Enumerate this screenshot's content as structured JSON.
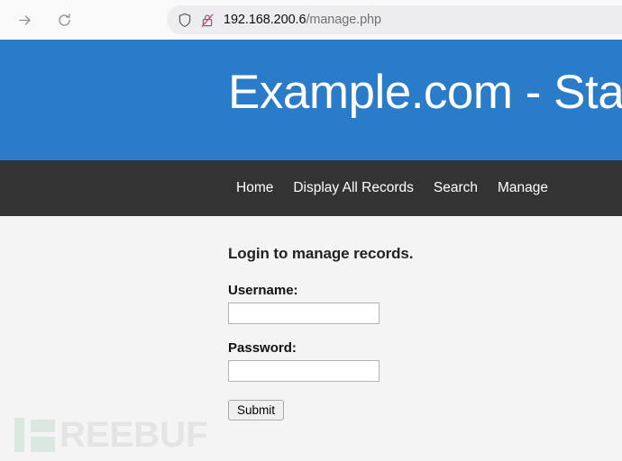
{
  "browser": {
    "forward_label": "Forward",
    "reload_label": "Reload",
    "url_host": "192.168.200.6",
    "url_path": "/manage.php",
    "shield_icon": "shield-icon",
    "insecure_icon": "lock-crossed-icon"
  },
  "site": {
    "banner_title": "Example.com - Staff",
    "banner_color": "#2b7cc8",
    "navbar_color": "#333333",
    "page_background": "#f4f4f4",
    "nav": [
      {
        "label": "Home"
      },
      {
        "label": "Display All Records"
      },
      {
        "label": "Search"
      },
      {
        "label": "Manage"
      }
    ]
  },
  "form": {
    "heading": "Login to manage records.",
    "username_label": "Username:",
    "username_value": "",
    "username_placeholder": "",
    "password_label": "Password:",
    "password_value": "",
    "password_placeholder": "",
    "submit_label": "Submit"
  },
  "watermark": {
    "text": "REEBUF",
    "color": "#e4e4e4"
  }
}
